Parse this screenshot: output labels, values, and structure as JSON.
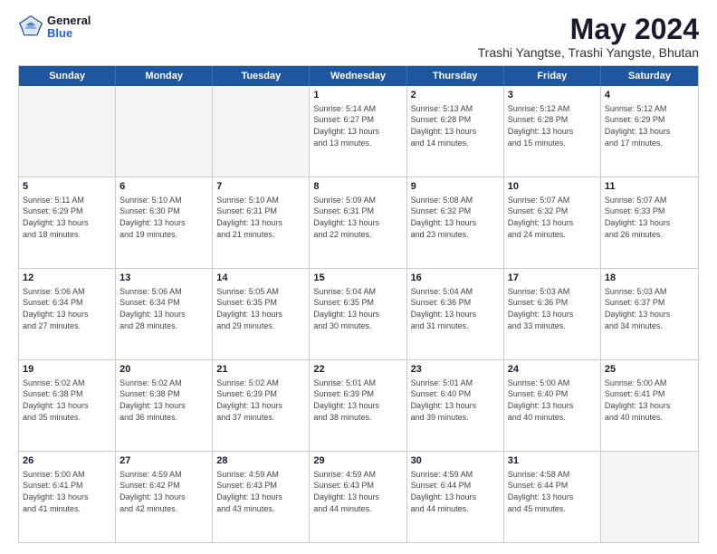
{
  "logo": {
    "general": "General",
    "blue": "Blue"
  },
  "title": "May 2024",
  "subtitle": "Trashi Yangtse, Trashi Yangste, Bhutan",
  "days": [
    "Sunday",
    "Monday",
    "Tuesday",
    "Wednesday",
    "Thursday",
    "Friday",
    "Saturday"
  ],
  "weeks": [
    [
      {
        "day": "",
        "detail": ""
      },
      {
        "day": "",
        "detail": ""
      },
      {
        "day": "",
        "detail": ""
      },
      {
        "day": "1",
        "detail": "Sunrise: 5:14 AM\nSunset: 6:27 PM\nDaylight: 13 hours\nand 13 minutes."
      },
      {
        "day": "2",
        "detail": "Sunrise: 5:13 AM\nSunset: 6:28 PM\nDaylight: 13 hours\nand 14 minutes."
      },
      {
        "day": "3",
        "detail": "Sunrise: 5:12 AM\nSunset: 6:28 PM\nDaylight: 13 hours\nand 15 minutes."
      },
      {
        "day": "4",
        "detail": "Sunrise: 5:12 AM\nSunset: 6:29 PM\nDaylight: 13 hours\nand 17 minutes."
      }
    ],
    [
      {
        "day": "5",
        "detail": "Sunrise: 5:11 AM\nSunset: 6:29 PM\nDaylight: 13 hours\nand 18 minutes."
      },
      {
        "day": "6",
        "detail": "Sunrise: 5:10 AM\nSunset: 6:30 PM\nDaylight: 13 hours\nand 19 minutes."
      },
      {
        "day": "7",
        "detail": "Sunrise: 5:10 AM\nSunset: 6:31 PM\nDaylight: 13 hours\nand 21 minutes."
      },
      {
        "day": "8",
        "detail": "Sunrise: 5:09 AM\nSunset: 6:31 PM\nDaylight: 13 hours\nand 22 minutes."
      },
      {
        "day": "9",
        "detail": "Sunrise: 5:08 AM\nSunset: 6:32 PM\nDaylight: 13 hours\nand 23 minutes."
      },
      {
        "day": "10",
        "detail": "Sunrise: 5:07 AM\nSunset: 6:32 PM\nDaylight: 13 hours\nand 24 minutes."
      },
      {
        "day": "11",
        "detail": "Sunrise: 5:07 AM\nSunset: 6:33 PM\nDaylight: 13 hours\nand 26 minutes."
      }
    ],
    [
      {
        "day": "12",
        "detail": "Sunrise: 5:06 AM\nSunset: 6:34 PM\nDaylight: 13 hours\nand 27 minutes."
      },
      {
        "day": "13",
        "detail": "Sunrise: 5:06 AM\nSunset: 6:34 PM\nDaylight: 13 hours\nand 28 minutes."
      },
      {
        "day": "14",
        "detail": "Sunrise: 5:05 AM\nSunset: 6:35 PM\nDaylight: 13 hours\nand 29 minutes."
      },
      {
        "day": "15",
        "detail": "Sunrise: 5:04 AM\nSunset: 6:35 PM\nDaylight: 13 hours\nand 30 minutes."
      },
      {
        "day": "16",
        "detail": "Sunrise: 5:04 AM\nSunset: 6:36 PM\nDaylight: 13 hours\nand 31 minutes."
      },
      {
        "day": "17",
        "detail": "Sunrise: 5:03 AM\nSunset: 6:36 PM\nDaylight: 13 hours\nand 33 minutes."
      },
      {
        "day": "18",
        "detail": "Sunrise: 5:03 AM\nSunset: 6:37 PM\nDaylight: 13 hours\nand 34 minutes."
      }
    ],
    [
      {
        "day": "19",
        "detail": "Sunrise: 5:02 AM\nSunset: 6:38 PM\nDaylight: 13 hours\nand 35 minutes."
      },
      {
        "day": "20",
        "detail": "Sunrise: 5:02 AM\nSunset: 6:38 PM\nDaylight: 13 hours\nand 36 minutes."
      },
      {
        "day": "21",
        "detail": "Sunrise: 5:02 AM\nSunset: 6:39 PM\nDaylight: 13 hours\nand 37 minutes."
      },
      {
        "day": "22",
        "detail": "Sunrise: 5:01 AM\nSunset: 6:39 PM\nDaylight: 13 hours\nand 38 minutes."
      },
      {
        "day": "23",
        "detail": "Sunrise: 5:01 AM\nSunset: 6:40 PM\nDaylight: 13 hours\nand 39 minutes."
      },
      {
        "day": "24",
        "detail": "Sunrise: 5:00 AM\nSunset: 6:40 PM\nDaylight: 13 hours\nand 40 minutes."
      },
      {
        "day": "25",
        "detail": "Sunrise: 5:00 AM\nSunset: 6:41 PM\nDaylight: 13 hours\nand 40 minutes."
      }
    ],
    [
      {
        "day": "26",
        "detail": "Sunrise: 5:00 AM\nSunset: 6:41 PM\nDaylight: 13 hours\nand 41 minutes."
      },
      {
        "day": "27",
        "detail": "Sunrise: 4:59 AM\nSunset: 6:42 PM\nDaylight: 13 hours\nand 42 minutes."
      },
      {
        "day": "28",
        "detail": "Sunrise: 4:59 AM\nSunset: 6:43 PM\nDaylight: 13 hours\nand 43 minutes."
      },
      {
        "day": "29",
        "detail": "Sunrise: 4:59 AM\nSunset: 6:43 PM\nDaylight: 13 hours\nand 44 minutes."
      },
      {
        "day": "30",
        "detail": "Sunrise: 4:59 AM\nSunset: 6:44 PM\nDaylight: 13 hours\nand 44 minutes."
      },
      {
        "day": "31",
        "detail": "Sunrise: 4:58 AM\nSunset: 6:44 PM\nDaylight: 13 hours\nand 45 minutes."
      },
      {
        "day": "",
        "detail": ""
      }
    ]
  ]
}
